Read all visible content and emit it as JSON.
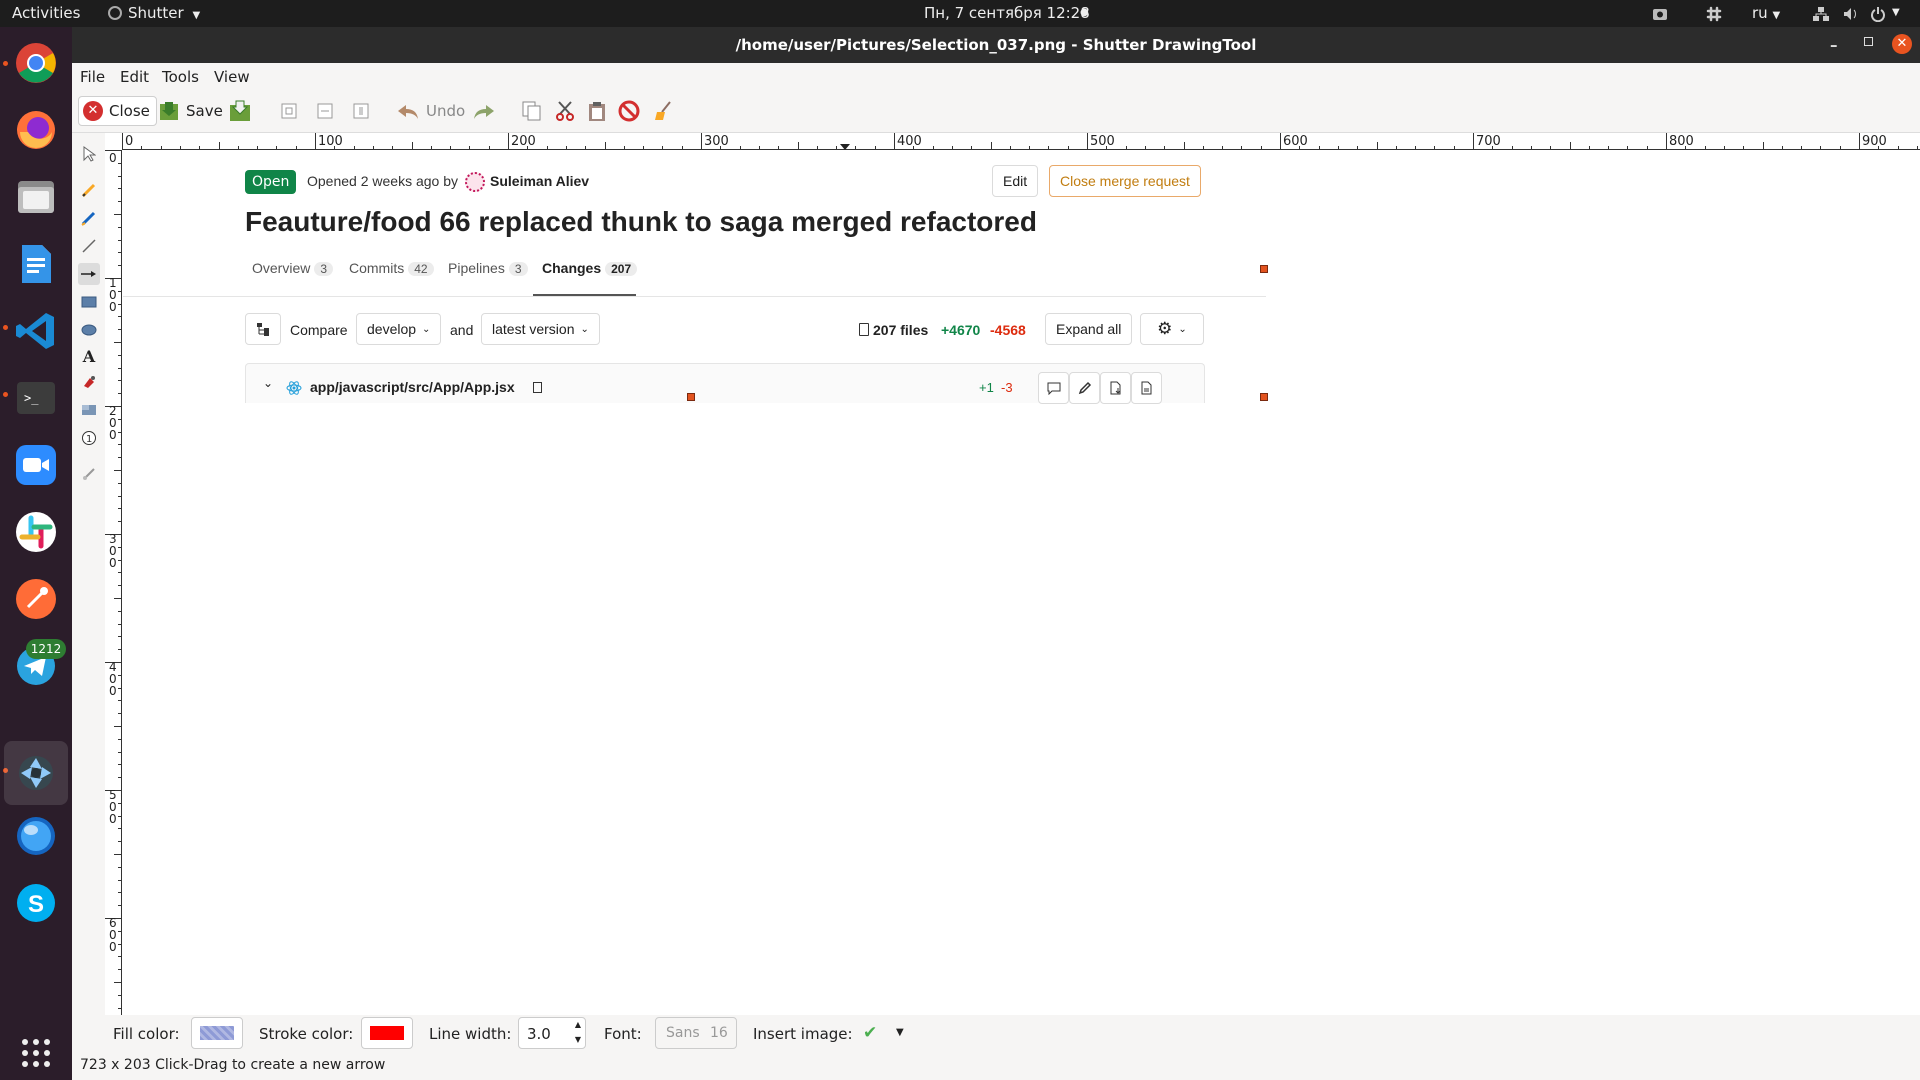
{
  "topbar": {
    "activities": "Activities",
    "app_menu": "Shutter",
    "datetime": "Пн, 7 сентября  12:28",
    "lang": "ru"
  },
  "dock": {
    "telegram_badge": "1212"
  },
  "window": {
    "title": "/home/user/Pictures/Selection_037.png - Shutter DrawingTool"
  },
  "menu": [
    "File",
    "Edit",
    "Tools",
    "View"
  ],
  "toolbar": {
    "close_label": "Close",
    "save_label": "Save",
    "undo_label": "Undo"
  },
  "ruler": {
    "h_labels": [
      "0",
      "100",
      "200",
      "300",
      "400",
      "500",
      "600",
      "700",
      "800",
      "900"
    ],
    "v_labels": [
      "0",
      "1\n0\n0",
      "2\n0\n0",
      "3\n0\n0",
      "4\n0\n0",
      "5\n0\n0",
      "6\n0\n0"
    ]
  },
  "screenshot": {
    "status": "Open",
    "opened_text": "Opened 2 weeks ago by",
    "author": "Suleiman Aliev",
    "edit_label": "Edit",
    "close_mr_label": "Close merge request",
    "title": "Feauture/food 66 replaced thunk to saga merged refactored",
    "tabs": [
      {
        "label": "Overview",
        "count": "3"
      },
      {
        "label": "Commits",
        "count": "42"
      },
      {
        "label": "Pipelines",
        "count": "3"
      },
      {
        "label": "Changes",
        "count": "207"
      }
    ],
    "compare_label": "Compare",
    "compare_from": "develop",
    "and_label": "and",
    "compare_to": "latest version",
    "files_count": "207 files",
    "additions": "+4670",
    "deletions": "-4568",
    "expand_all": "Expand all",
    "file_path": "app/javascript/src/App/App.jsx",
    "file_add": "+1",
    "file_del": "-3",
    "colors": {
      "green": "#108548",
      "red": "#dd2b0e",
      "orange": "#c17d10"
    }
  },
  "bottom": {
    "fill_label": "Fill color:",
    "stroke_label": "Stroke color:",
    "line_width_label": "Line width:",
    "line_width_value": "3.0",
    "font_label": "Font:",
    "font_name": "Sans",
    "font_size": "16",
    "insert_image_label": "Insert image:",
    "stroke_color": "#ff0000"
  },
  "status": "723 x 203 Click-Drag to create a new arrow"
}
